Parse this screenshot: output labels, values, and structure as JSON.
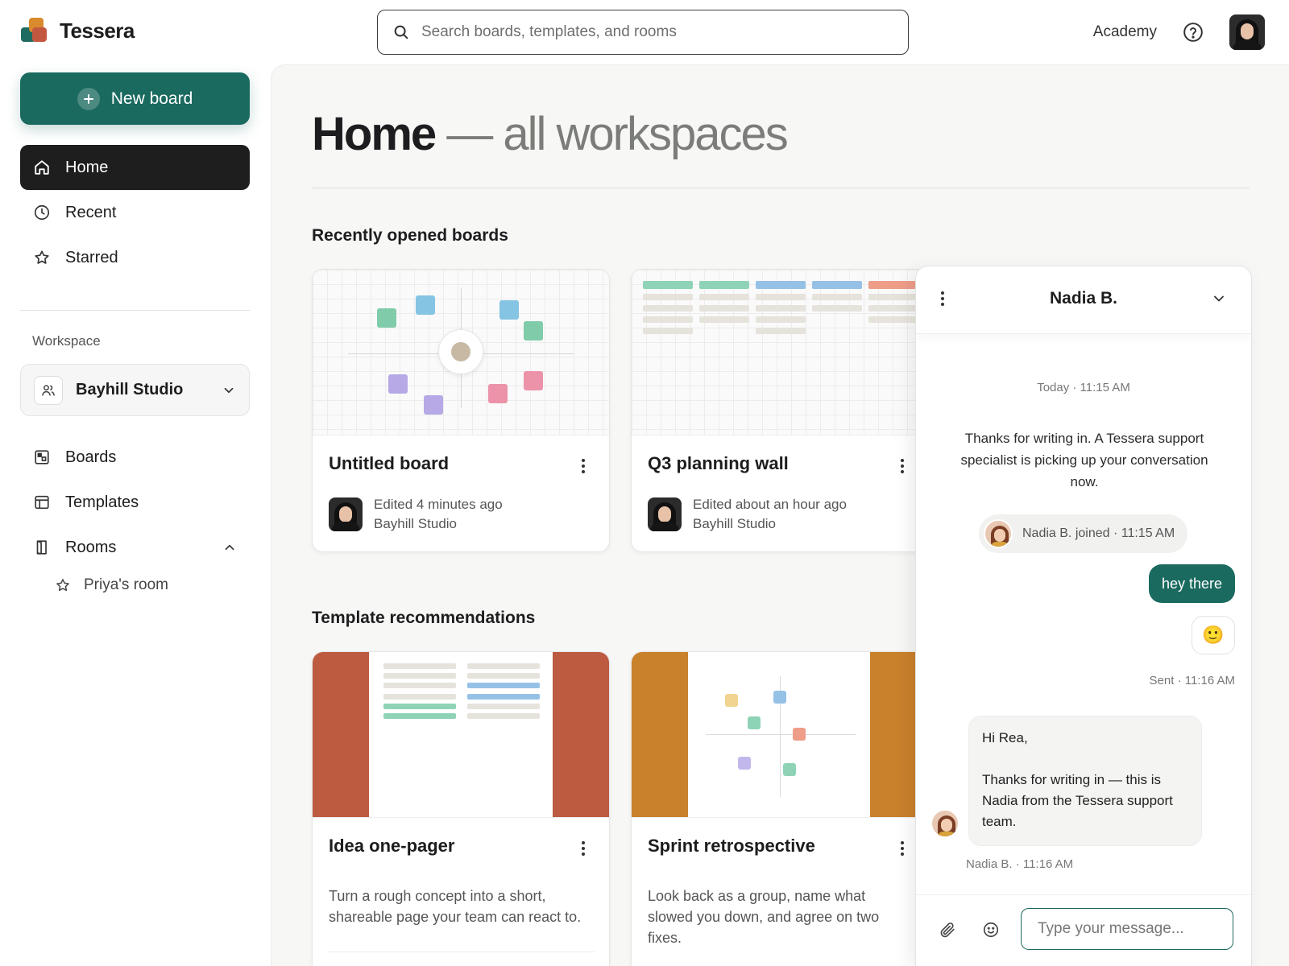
{
  "brand": {
    "name": "Tessera"
  },
  "search": {
    "placeholder": "Search boards, templates, and rooms"
  },
  "topnav": {
    "academy": "Academy"
  },
  "sidebar": {
    "new_board": "New board",
    "nav": [
      {
        "label": "Home",
        "icon": "home-icon",
        "active": true
      },
      {
        "label": "Recent",
        "icon": "clock-icon"
      },
      {
        "label": "Starred",
        "icon": "star-icon"
      }
    ],
    "workspace_label": "Workspace",
    "workspace_name": "Bayhill Studio",
    "sections": [
      {
        "label": "Boards",
        "icon": "boards-icon"
      },
      {
        "label": "Templates",
        "icon": "templates-icon"
      },
      {
        "label": "Rooms",
        "icon": "rooms-icon",
        "expanded": true
      }
    ],
    "rooms": [
      {
        "label": "Priya's room",
        "icon": "star-icon"
      }
    ]
  },
  "main": {
    "title_strong": "Home",
    "title_light": "— all workspaces",
    "recent_title": "Recently opened boards",
    "recent_boards": [
      {
        "title": "Untitled board",
        "edited": "Edited 4 minutes ago",
        "workspace": "Bayhill Studio"
      },
      {
        "title": "Q3 planning wall",
        "edited": "Edited about an hour ago",
        "workspace": "Bayhill Studio"
      }
    ],
    "templates_title": "Template recommendations",
    "templates": [
      {
        "title": "Idea one-pager",
        "description": "Turn a rough concept into a short, shareable page your team can react to.",
        "accent": "#bc5b40"
      },
      {
        "title": "Sprint retrospective",
        "description": "Look back as a group, name what slowed you down, and agree on two fixes.",
        "accent": "#c9812c"
      }
    ]
  },
  "chat": {
    "agent_name": "Nadia B.",
    "day_timestamp": "Today · 11:15 AM",
    "system_message": "Thanks for writing in. A Tessera support specialist is picking up your conversation now.",
    "joined_text": "Nadia B. joined · 11:15 AM",
    "user_message": "hey there",
    "user_emoji": "🙂",
    "sent_status": "Sent · 11:16 AM",
    "agent_greeting": "Hi Rea,",
    "agent_message": "Thanks for writing in — this is Nadia from the Tessera support team.",
    "agent_meta": "Nadia B. · 11:16 AM",
    "input_placeholder": "Type your message..."
  },
  "colors": {
    "primary": "#1a6a5f",
    "sidebar_active": "#1e1e1e",
    "idea_accent": "#bc5b40",
    "sprint_accent": "#c9812c"
  }
}
